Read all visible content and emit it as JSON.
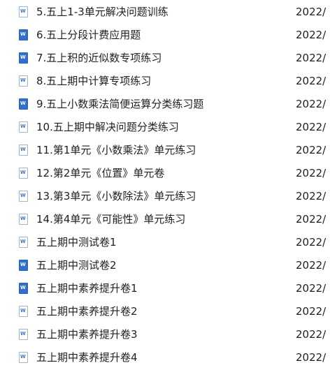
{
  "files": [
    {
      "name": "5.五上1-3单元解决问题训练",
      "date": "2022/",
      "icon": "word-doc-icon",
      "icon_style": "outline"
    },
    {
      "name": "6.五上分段计费应用题",
      "date": "2022/",
      "icon": "word-doc-icon",
      "icon_style": "filled"
    },
    {
      "name": "7.五上积的近似数专项练习",
      "date": "2022/",
      "icon": "word-doc-icon",
      "icon_style": "filled"
    },
    {
      "name": "8.五上期中计算专项练习",
      "date": "2022/",
      "icon": "word-doc-icon",
      "icon_style": "outline"
    },
    {
      "name": "9.五上小数乘法简便运算分类练习题",
      "date": "2022/",
      "icon": "word-doc-icon",
      "icon_style": "filled"
    },
    {
      "name": "10.五上期中解决问题分类练习",
      "date": "2022/",
      "icon": "word-doc-icon",
      "icon_style": "outline"
    },
    {
      "name": "11.第1单元《小数乘法》单元练习",
      "date": "2022/",
      "icon": "word-doc-icon",
      "icon_style": "outline"
    },
    {
      "name": "12.第2单元《位置》单元卷",
      "date": "2022/",
      "icon": "word-doc-icon",
      "icon_style": "outline"
    },
    {
      "name": "13.第3单元《小数除法》单元练习",
      "date": "2022/",
      "icon": "word-doc-icon",
      "icon_style": "outline"
    },
    {
      "name": "14.第4单元《可能性》单元练习",
      "date": "2022/",
      "icon": "word-doc-icon",
      "icon_style": "outline"
    },
    {
      "name": "五上期中测试卷1",
      "date": "2022/",
      "icon": "word-doc-icon",
      "icon_style": "outline"
    },
    {
      "name": "五上期中测试卷2",
      "date": "2022/",
      "icon": "word-doc-icon",
      "icon_style": "filled"
    },
    {
      "name": "五上期中素养提升卷1",
      "date": "2022/",
      "icon": "word-doc-icon",
      "icon_style": "filled"
    },
    {
      "name": "五上期中素养提升卷2",
      "date": "2022/",
      "icon": "word-doc-icon",
      "icon_style": "outline"
    },
    {
      "name": "五上期中素养提升卷3",
      "date": "2022/",
      "icon": "word-doc-icon",
      "icon_style": "outline"
    },
    {
      "name": "五上期中素养提升卷4",
      "date": "2022/",
      "icon": "word-doc-icon",
      "icon_style": "outline"
    }
  ],
  "colors": {
    "text": "#1f1f1f",
    "icon_fill": "#2f6fd0",
    "icon_outline": "#9fb4cf"
  }
}
